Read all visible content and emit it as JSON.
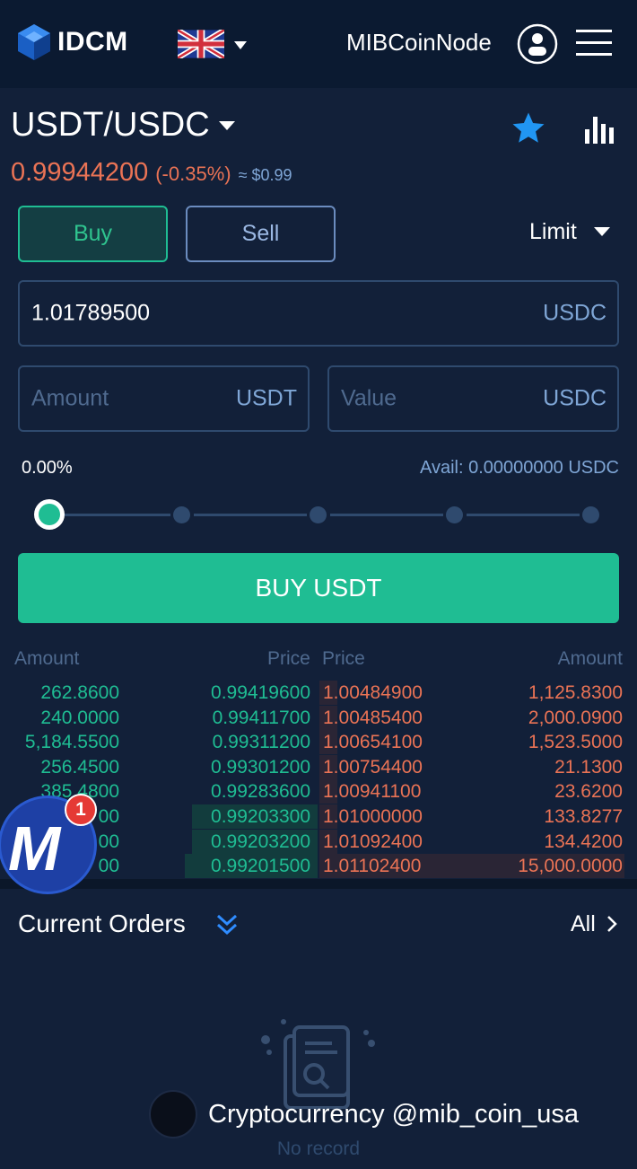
{
  "header": {
    "brand": "IDCM",
    "username": "MIBCoinNode"
  },
  "market": {
    "pair": "USDT/USDC",
    "price": "0.99944200",
    "change": "(-0.35%)",
    "usd_value": "≈ $0.99"
  },
  "trade": {
    "buy_tab": "Buy",
    "sell_tab": "Sell",
    "order_type": "Limit",
    "price_value": "1.01789500",
    "price_unit": "USDC",
    "amount_placeholder": "Amount",
    "amount_unit": "USDT",
    "value_placeholder": "Value",
    "value_unit": "USDC",
    "percent": "0.00%",
    "slider_level": 0,
    "available": "Avail: 0.00000000 USDC",
    "buy_button": "BUY USDT"
  },
  "orderbook": {
    "headers": {
      "bid_amount": "Amount",
      "bid_price": "Price",
      "ask_price": "Price",
      "ask_amount": "Amount"
    },
    "rows": [
      {
        "bid_amount": "262.8600",
        "bid_price": "0.99419600",
        "ask_price": "1.00484900",
        "ask_amount": "1,125.8300"
      },
      {
        "bid_amount": "240.0000",
        "bid_price": "0.99411700",
        "ask_price": "1.00485400",
        "ask_amount": "2,000.0900"
      },
      {
        "bid_amount": "5,184.5500",
        "bid_price": "0.99311200",
        "ask_price": "1.00654100",
        "ask_amount": "1,523.5000"
      },
      {
        "bid_amount": "256.4500",
        "bid_price": "0.99301200",
        "ask_price": "1.00754400",
        "ask_amount": "21.1300"
      },
      {
        "bid_amount": "385.4800",
        "bid_price": "0.99283600",
        "ask_price": "1.00941100",
        "ask_amount": "23.6200"
      },
      {
        "bid_amount": "00",
        "bid_price": "0.99203300",
        "ask_price": "1.01000000",
        "ask_amount": "133.8277"
      },
      {
        "bid_amount": "00",
        "bid_price": "0.99203200",
        "ask_price": "1.01092400",
        "ask_amount": "134.4200"
      },
      {
        "bid_amount": "00",
        "bid_price": "0.99201500",
        "ask_price": "1.01102400",
        "ask_amount": "15,000.0000"
      }
    ]
  },
  "orders": {
    "title": "Current Orders",
    "all_link": "All",
    "empty_text": "No record"
  },
  "overlay": {
    "badge_letter": "M",
    "notification_count": "1",
    "watermark_text": "Cryptocurrency @mib_coin_usa"
  },
  "colors": {
    "background": "#122039",
    "header": "#0b1a31",
    "buy_green": "#1fbd93",
    "sell_red": "#ea7355",
    "muted_blue": "#7fa6d6",
    "star_blue": "#2196f3"
  },
  "icons": [
    "idcm-logo-icon",
    "uk-flag-icon",
    "user-icon",
    "menu-icon",
    "star-icon",
    "chart-icon",
    "double-chevron-down-icon",
    "chevron-right-icon",
    "empty-document-icon"
  ]
}
